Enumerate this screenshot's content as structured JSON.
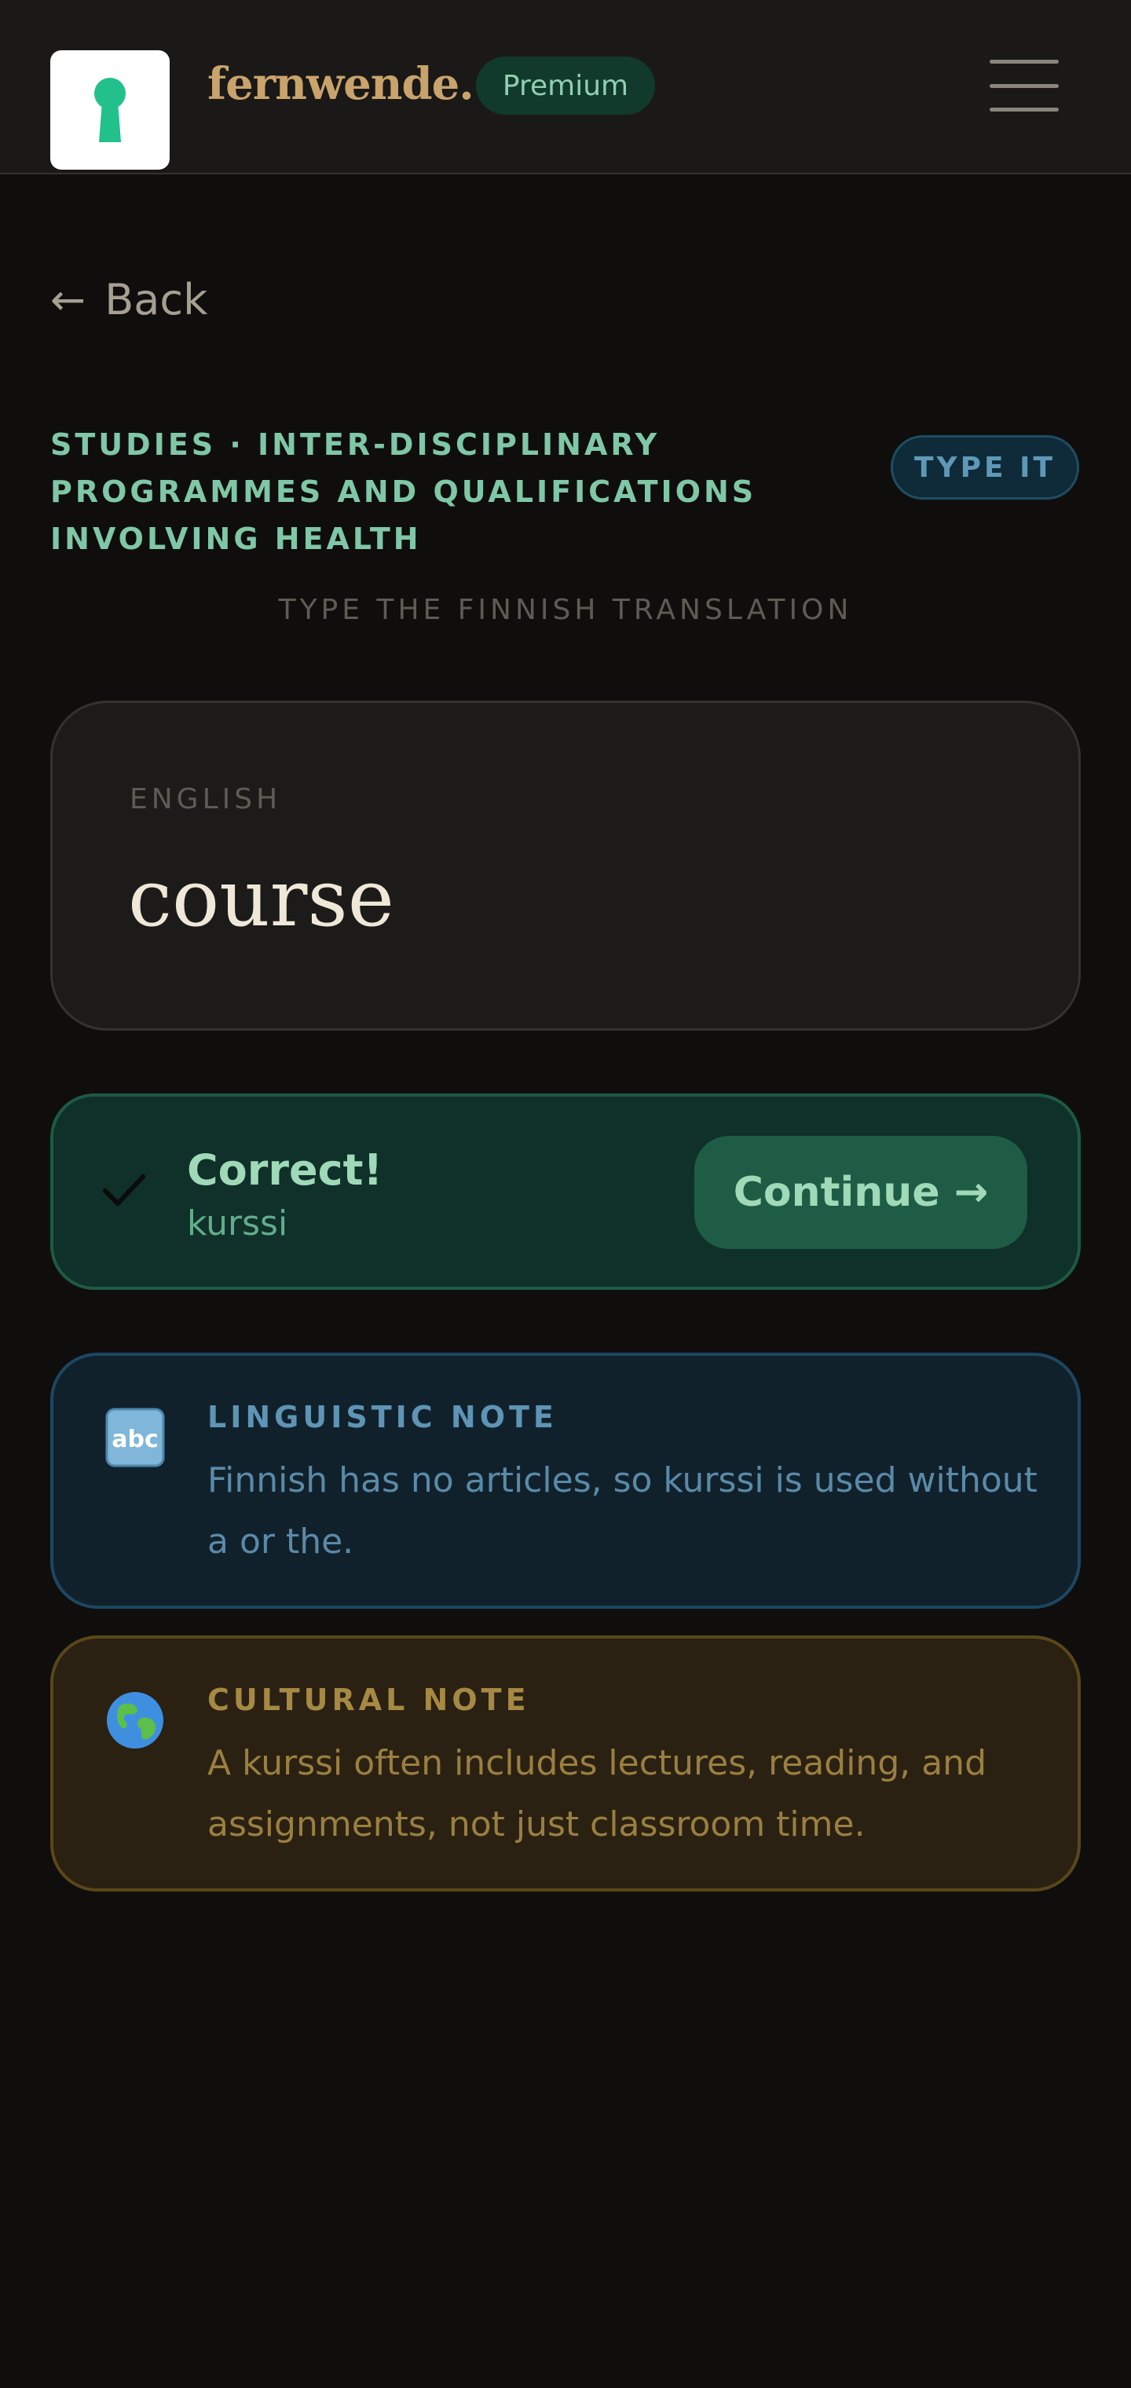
{
  "header": {
    "brand": "fernwende.",
    "badge": "Premium",
    "logo_icon": "keyhole-icon",
    "menu_icon": "hamburger-menu-icon"
  },
  "nav": {
    "back_arrow": "←",
    "back_label": "Back"
  },
  "lesson": {
    "breadcrumb": "STUDIES · INTER-DISCIPLINARY PROGRAMMES AND QUALIFICATIONS INVOLVING HEALTH",
    "mode_badge": "TYPE IT",
    "instruction": "TYPE THE FINNISH TRANSLATION"
  },
  "prompt": {
    "label": "ENGLISH",
    "word": "course"
  },
  "result": {
    "title": "Correct!",
    "answer": "kurssi",
    "continue_label": "Continue →"
  },
  "notes": {
    "linguistic": {
      "icon": "abc-icon",
      "icon_text": "abc",
      "title": "LINGUISTIC NOTE",
      "text": "Finnish has no articles, so kurssi is used without a or the."
    },
    "cultural": {
      "icon": "globe-icon",
      "title": "CULTURAL NOTE",
      "text": "A kurssi often includes lectures, reading, and assignments, not just classroom time."
    }
  },
  "colors": {
    "background": "#0f0e0d",
    "header": "#1a1917",
    "brand": "#c9a36b",
    "accent_green": "#9fd9b8",
    "note_blue": "#5e94b4",
    "note_gold": "#a58944"
  }
}
